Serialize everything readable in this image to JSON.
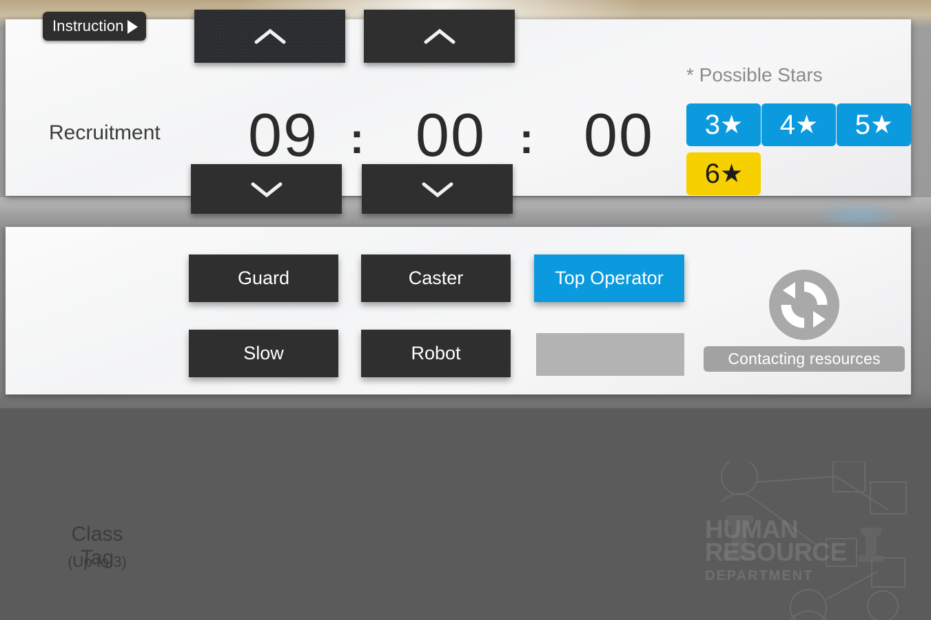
{
  "instruction": {
    "label": "Instruction",
    "icon": "play-triangle-icon"
  },
  "recruitment": {
    "label": "Recruitment",
    "timer": {
      "hours": "09",
      "minutes": "00",
      "seconds": "00",
      "separator": ":"
    },
    "steppers": {
      "hours_up": "▲",
      "hours_down": "▼",
      "minutes_up": "▲",
      "minutes_down": "▼"
    },
    "possible_stars": {
      "label": "* Possible Stars",
      "options": [
        {
          "num": "3",
          "glyph": "★",
          "state": "active",
          "color": "#0c9ade",
          "text_color": "#ffffff"
        },
        {
          "num": "4",
          "glyph": "★",
          "state": "active",
          "color": "#0c9ade",
          "text_color": "#ffffff"
        },
        {
          "num": "5",
          "glyph": "★",
          "state": "active",
          "color": "#0c9ade",
          "text_color": "#ffffff"
        },
        {
          "num": "6",
          "glyph": "★",
          "state": "highlighted",
          "color": "#f7d000",
          "text_color": "#1b1b1b"
        }
      ]
    }
  },
  "class_tag": {
    "label": "Class Tag",
    "sublabel": "(Up to 3)",
    "tags": [
      {
        "label": "Guard",
        "state": "default"
      },
      {
        "label": "Caster",
        "state": "default"
      },
      {
        "label": "Top Operator",
        "state": "selected"
      },
      {
        "label": "Slow",
        "state": "default"
      },
      {
        "label": "Robot",
        "state": "default"
      },
      {
        "label": "",
        "state": "empty"
      }
    ]
  },
  "watermark": {
    "line1": "HUMAN",
    "line2": "RESOURCE",
    "line3": "DEPARTMENT"
  },
  "status": {
    "toast": "Contacting resources",
    "icon": "refresh-icon"
  },
  "colors": {
    "accent_blue": "#0c9ade",
    "highlight_yellow": "#f7d000",
    "button_dark": "#2f2f2f",
    "panel_bg": "#f5f5f6",
    "disabled_gray": "#b3b3b3"
  }
}
